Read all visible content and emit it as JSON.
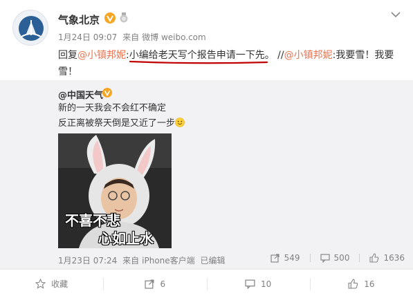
{
  "post": {
    "username": "气象北京",
    "date": "1月24日 09:07",
    "source_prefix": "来自",
    "source": "微博 weibo.com",
    "reply": {
      "prefix": "回复",
      "mention1": "@小镇邦妮",
      "colon": ":",
      "body": "小编给老天写个报告申请一下先。",
      "sep": " //",
      "mention2": "@小镇邦妮",
      "tail": ":我要雪！我要雪！"
    }
  },
  "repost": {
    "username": "@中国天气",
    "line1": "新的一天我会不会红不确定",
    "line2": "反正离被祭天倒是又近了一步",
    "image_caption_1": "不喜不悲",
    "image_caption_2": "心如止水",
    "date": "1月23日 07:24",
    "source_prefix": "来自",
    "source": "iPhone客户端",
    "edited": "已编辑",
    "shares": "549",
    "comments": "500",
    "likes": "1636"
  },
  "actions": {
    "favorite": "收藏",
    "share_count": "6",
    "comment_count": "10",
    "like_count": "16"
  },
  "colors": {
    "link": "#eb7350",
    "repost_bg": "#f2f2f5",
    "verified": "#f6a623",
    "underline": "#c00000"
  }
}
